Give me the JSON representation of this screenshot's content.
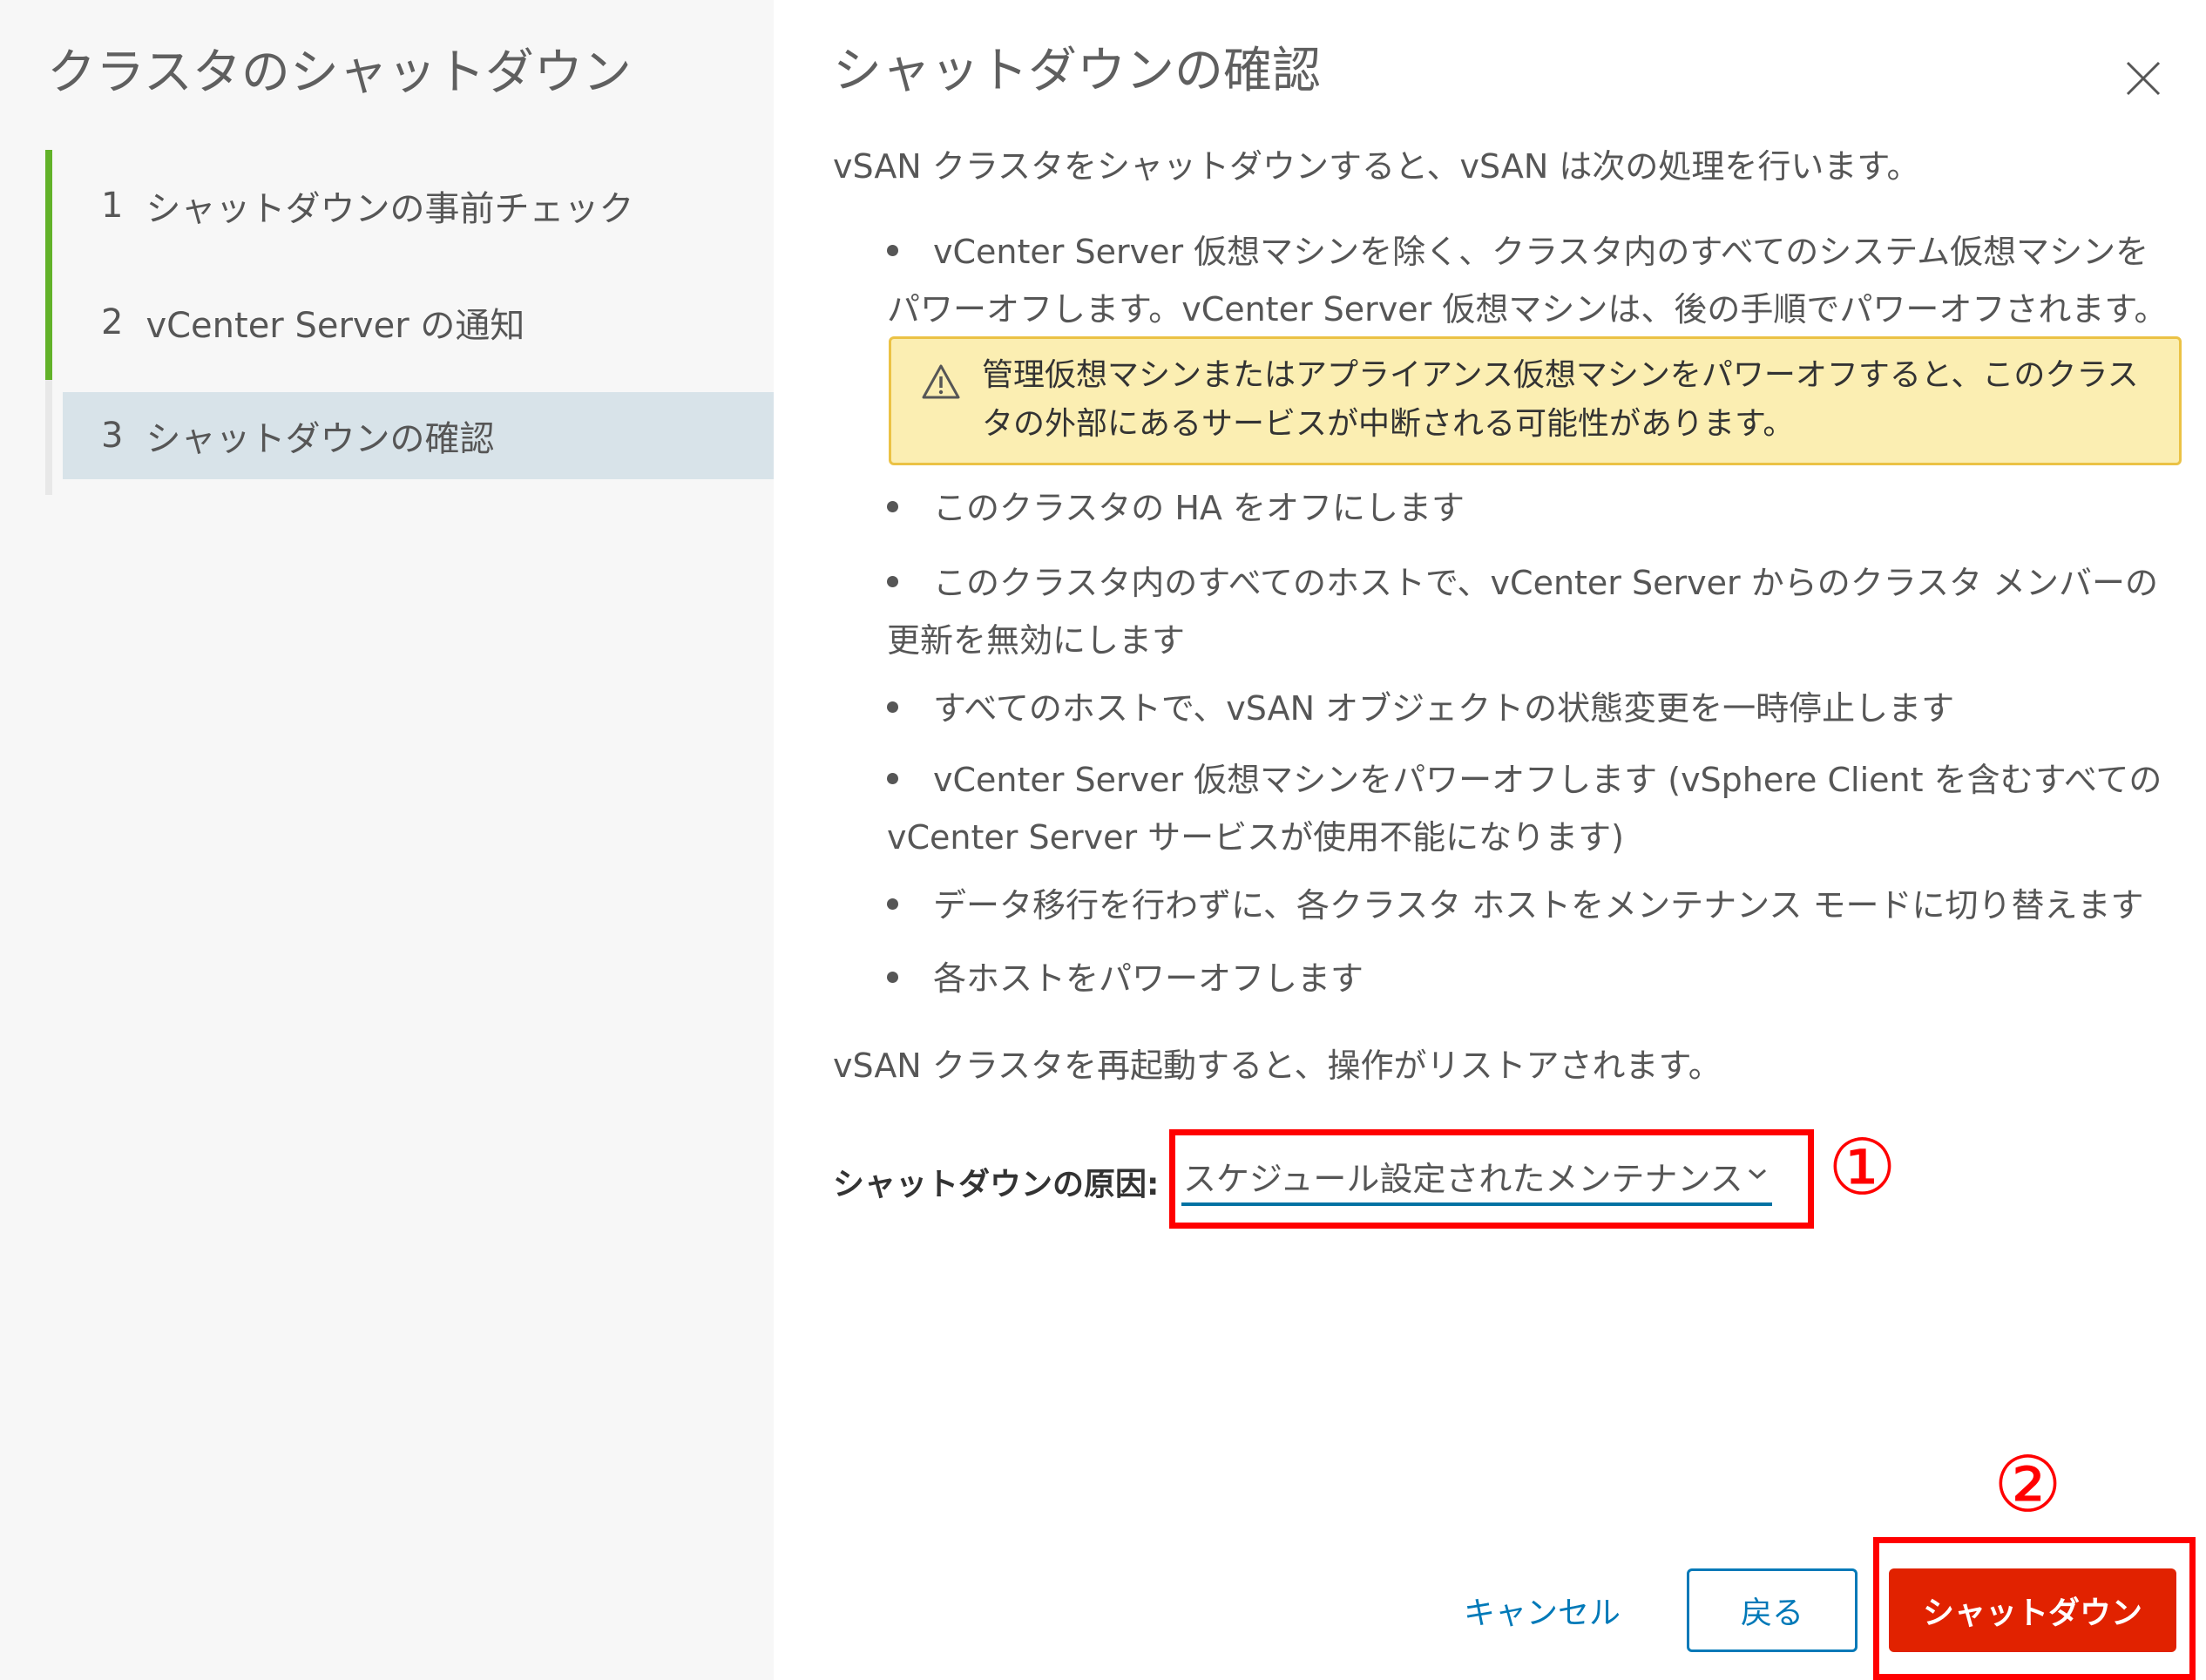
{
  "sidebar": {
    "title": "クラスタのシャットダウン",
    "steps": [
      {
        "num": "1",
        "label": "シャットダウンの事前チェック"
      },
      {
        "num": "2",
        "label": "vCenter Server の通知"
      },
      {
        "num": "3",
        "label": "シャットダウンの確認"
      }
    ]
  },
  "main": {
    "title": "シャットダウンの確認",
    "intro": "vSAN クラスタをシャットダウンすると、vSAN は次の処理を行います。",
    "bullets": [
      "vCenter Server 仮想マシンを除く、クラスタ内のすべてのシステム仮想マシンをパワーオフします。vCenter Server 仮想マシンは、後の手順でパワーオフされます。",
      "このクラスタの HA をオフにします",
      "このクラスタ内のすべてのホストで、vCenter Server からのクラスタ メンバーの更新を無効にします",
      "すべてのホストで、vSAN オブジェクトの状態変更を一時停止します",
      "vCenter Server 仮想マシンをパワーオフします (vSphere Client を含むすべての vCenter Server サービスが使用不能になります)",
      "データ移行を行わずに、各クラスタ ホストをメンテナンス モードに切り替えます",
      "各ホストをパワーオフします"
    ],
    "warning": "管理仮想マシンまたはアプライアンス仮想マシンをパワーオフすると、このクラスタの外部にあるサービスが中断される可能性があります。",
    "outro": "vSAN クラスタを再起動すると、操作がリストアされます。",
    "reason_label": "シャットダウンの原因:",
    "reason_value": "スケジュール設定されたメンテナンス"
  },
  "annotations": {
    "marker1": "①",
    "marker2": "②",
    "color": "#ff0000"
  },
  "footer": {
    "cancel": "キャンセル",
    "back": "戻る",
    "shutdown": "シャットダウン"
  },
  "colors": {
    "accent": "#0079b8",
    "danger": "#e12200",
    "progress": "#62b229",
    "warning_bg": "#fbeeb2"
  }
}
